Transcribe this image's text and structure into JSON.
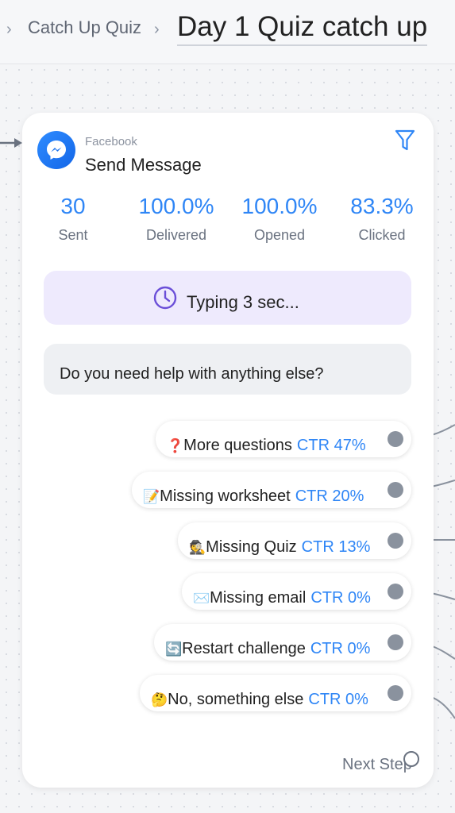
{
  "breadcrumb": {
    "parent": "Catch Up Quiz",
    "title": "Day 1 Quiz catch up"
  },
  "step": {
    "channel": "Facebook",
    "title": "Send Message",
    "channel_icon": "messenger-icon",
    "filter_icon": "filter-icon"
  },
  "stats": [
    {
      "value": "30",
      "label": "Sent"
    },
    {
      "value": "100.0%",
      "label": "Delivered"
    },
    {
      "value": "100.0%",
      "label": "Opened"
    },
    {
      "value": "83.3%",
      "label": "Clicked"
    }
  ],
  "typing": {
    "icon": "clock-icon",
    "text": "Typing 3 sec..."
  },
  "message": {
    "text": "Do you need help with anything else?"
  },
  "quick_replies": [
    {
      "emoji": "❓",
      "label": "More questions",
      "ctr": "CTR 47%"
    },
    {
      "emoji": "📝",
      "label": "Missing worksheet",
      "ctr": "CTR 20%"
    },
    {
      "emoji": "🕵",
      "label": "Missing Quiz",
      "ctr": "CTR 13%"
    },
    {
      "emoji": "✉️",
      "label": "Missing email",
      "ctr": "CTR 0%"
    },
    {
      "emoji": "🔄",
      "label": "Restart challenge",
      "ctr": "CTR 0%"
    },
    {
      "emoji": "🤔",
      "label": "No, something else",
      "ctr": "CTR 0%"
    }
  ],
  "next_step": {
    "label": "Next Step"
  },
  "colors": {
    "accent": "#2f86f6",
    "typing_bg": "#eeeafd",
    "typing_icon": "#6b4fd8",
    "connector": "#8a929e"
  }
}
